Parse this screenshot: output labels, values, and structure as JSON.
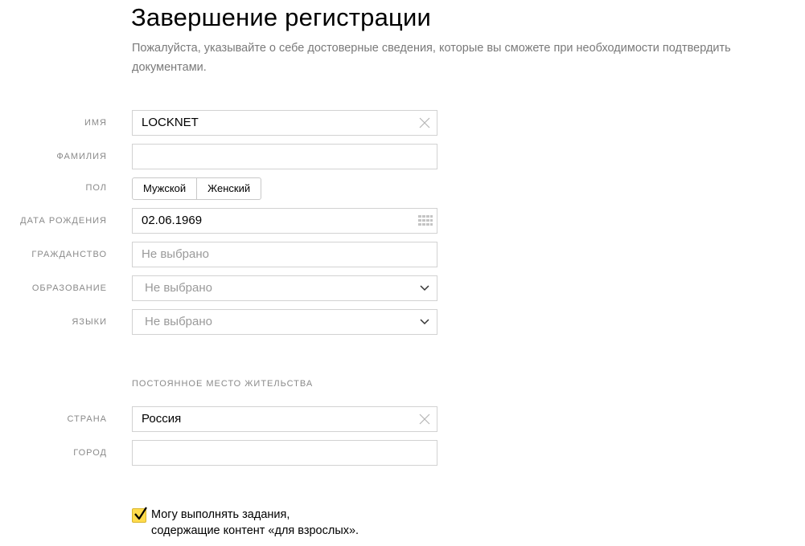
{
  "page": {
    "title": "Завершение регистрации",
    "subtitle": "Пожалуйста, указывайте о себе достоверные сведения, которые вы сможете при необходимости подтвердить документами."
  },
  "form": {
    "name": {
      "label": "ИМЯ",
      "value": "LOCKNET",
      "icon": "clear-icon"
    },
    "surname": {
      "label": "ФАМИЛИЯ",
      "value": ""
    },
    "gender": {
      "label": "ПОЛ",
      "options": [
        "Мужской",
        "Женский"
      ]
    },
    "birthdate": {
      "label": "ДАТА РОЖДЕНИЯ",
      "value": "02.06.1969",
      "icon": "calendar-icon"
    },
    "citizenship": {
      "label": "ГРАЖДАНСТВО",
      "placeholder": "Не выбрано"
    },
    "education": {
      "label": "ОБРАЗОВАНИЕ",
      "selected": "Не выбрано",
      "icon": "chevron-down-icon"
    },
    "languages": {
      "label": "ЯЗЫКИ",
      "selected": "Не выбрано",
      "icon": "chevron-down-icon"
    }
  },
  "residence": {
    "section_title": "ПОСТОЯННОЕ МЕСТО ЖИТЕЛЬСТВА",
    "country": {
      "label": "СТРАНА",
      "value": "Россия",
      "icon": "clear-icon"
    },
    "city": {
      "label": "ГОРОД",
      "value": ""
    }
  },
  "adult_content": {
    "checked": true,
    "label_line1": "Могу выполнять задания,",
    "label_line2": "содержащие контент «для взрослых»."
  },
  "colors": {
    "checkbox_accent": "#ffdb4d",
    "label_gray": "#8a8a8a",
    "border": "#d2d2d2"
  }
}
